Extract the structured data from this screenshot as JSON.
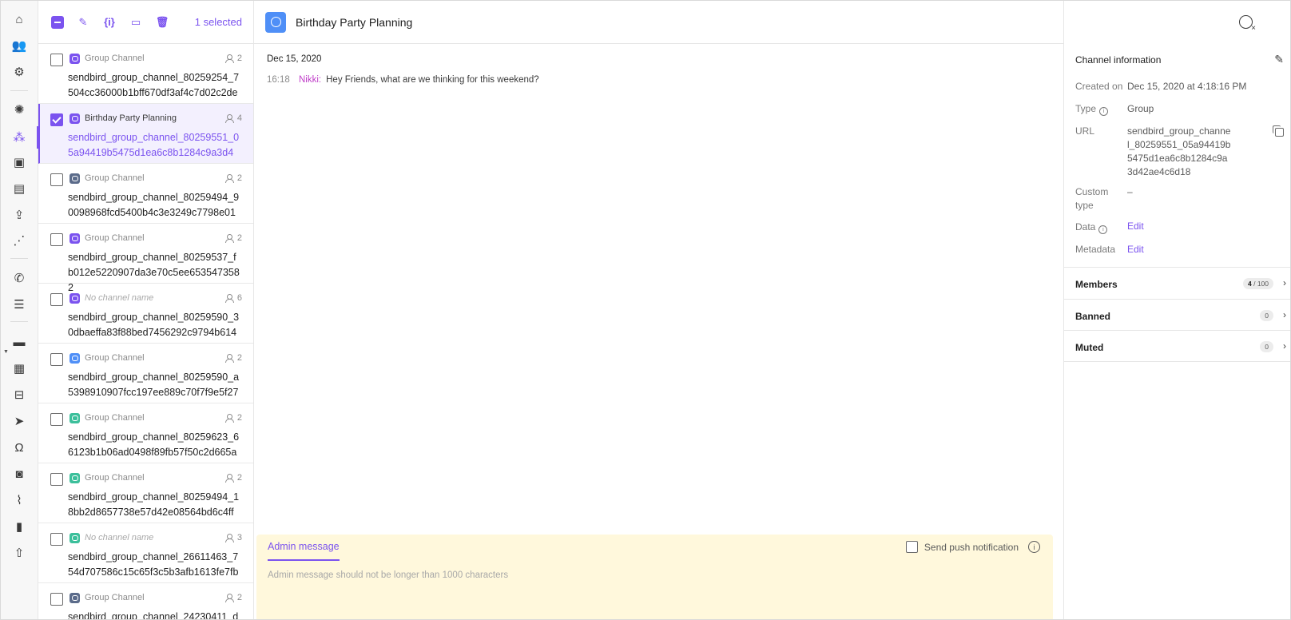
{
  "toolbar": {
    "selected_text": "1 selected"
  },
  "channels": [
    {
      "name": "Group Channel",
      "members": "2",
      "url": "sendbird_group_channel_80259254_7504cc36000b1bff670df3af4c7d02c2de",
      "color": "#7b53ef",
      "italic": false,
      "selected": false
    },
    {
      "name": "Birthday Party Planning",
      "members": "4",
      "url": "sendbird_group_channel_80259551_05a94419b5475d1ea6c8b1284c9a3d4",
      "color": "#7b53ef",
      "italic": false,
      "selected": true
    },
    {
      "name": "Group Channel",
      "members": "2",
      "url": "sendbird_group_channel_80259494_90098968fcd5400b4c3e3249c7798e01",
      "color": "#5b6b8a",
      "italic": false,
      "selected": false
    },
    {
      "name": "Group Channel",
      "members": "2",
      "url": "sendbird_group_channel_80259537_fb012e5220907da3e70c5ee6535473582",
      "color": "#7b53ef",
      "italic": false,
      "selected": false
    },
    {
      "name": "No channel name",
      "members": "6",
      "url": "sendbird_group_channel_80259590_30dbaeffa83f88bed7456292c9794b614",
      "color": "#7b53ef",
      "italic": true,
      "selected": false
    },
    {
      "name": "Group Channel",
      "members": "2",
      "url": "sendbird_group_channel_80259590_a5398910907fcc197ee889c70f7f9e5f27",
      "color": "#4f8ff7",
      "italic": false,
      "selected": false
    },
    {
      "name": "Group Channel",
      "members": "2",
      "url": "sendbird_group_channel_80259623_66123b1b06ad0498f89fb57f50c2d665a",
      "color": "#3cbf9b",
      "italic": false,
      "selected": false
    },
    {
      "name": "Group Channel",
      "members": "2",
      "url": "sendbird_group_channel_80259494_18bb2d8657738e57d42e08564bd6c4ff",
      "color": "#3cbf9b",
      "italic": false,
      "selected": false
    },
    {
      "name": "No channel name",
      "members": "3",
      "url": "sendbird_group_channel_26611463_754d707586c15c65f3c5b3afb1613fe7fb",
      "color": "#3cbf9b",
      "italic": true,
      "selected": false
    },
    {
      "name": "Group Channel",
      "members": "2",
      "url": "sendbird_group_channel_24230411_d",
      "color": "#5b6b8a",
      "italic": false,
      "selected": false
    }
  ],
  "chat": {
    "title": "Birthday Party Planning",
    "date": "Dec 15, 2020",
    "messages": [
      {
        "time": "16:18",
        "sender": "Nikki:",
        "text": "Hey Friends, what are we thinking for this weekend?"
      }
    ],
    "admin_tab": "Admin message",
    "push_label": "Send push notification",
    "admin_placeholder": "Admin message should not be longer than 1000 characters"
  },
  "info": {
    "header": "Channel information",
    "created_label": "Created on",
    "created_value": "Dec 15, 2020 at 4:18:16 PM",
    "type_label": "Type",
    "type_value": "Group",
    "url_label": "URL",
    "url_value": "sendbird_group_channel_80259551_05a94419b5475d1ea6c8b1284c9a3d42ae4c6d18",
    "custom_type_label": "Custom type",
    "custom_type_value": "–",
    "data_label": "Data",
    "data_value": "Edit",
    "metadata_label": "Metadata",
    "metadata_value": "Edit",
    "members_label": "Members",
    "members_count": "4",
    "members_max": "/ 100",
    "banned_label": "Banned",
    "banned_count": "0",
    "muted_label": "Muted",
    "muted_count": "0"
  },
  "colors": {
    "accent": "#7b53ef",
    "sender": "#c03fc9",
    "admin_bg": "#fff8dc"
  },
  "icons": {
    "rail": [
      "home-icon",
      "users-icon",
      "settings-icon",
      "chat-app-icon",
      "group-channels-icon",
      "reported-icon",
      "messages-icon",
      "upload-icon",
      "analytics-icon",
      "calls-icon",
      "list-icon",
      "desk-icon",
      "tickets-icon",
      "inbox-icon",
      "send-icon",
      "headset-icon",
      "contacts-icon",
      "monitor-icon",
      "stats-icon",
      "export-icon"
    ]
  }
}
